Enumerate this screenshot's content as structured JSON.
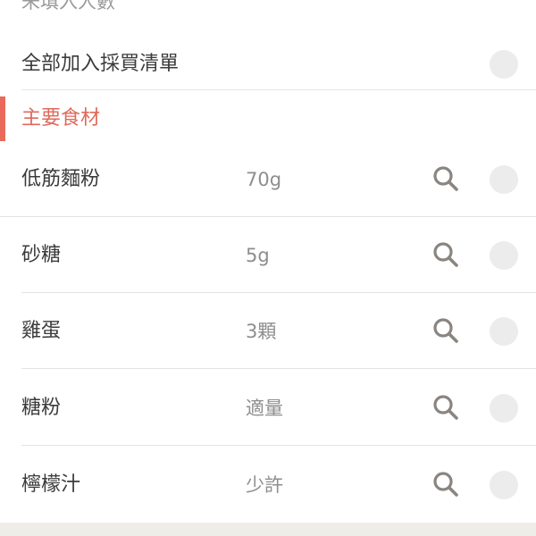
{
  "header_note": "未填入人數",
  "add_all": {
    "label": "全部加入採買清單"
  },
  "section": {
    "title": "主要食材"
  },
  "colors": {
    "accent": "#e96a5a",
    "checkbox": "#ececec",
    "search_icon": "#8a8580"
  },
  "ingredients": [
    {
      "name": "低筋麵粉",
      "qty": "70g"
    },
    {
      "name": "砂糖",
      "qty": "5g"
    },
    {
      "name": "雞蛋",
      "qty": "3顆"
    },
    {
      "name": "糖粉",
      "qty": "適量"
    },
    {
      "name": "檸檬汁",
      "qty": "少許"
    }
  ]
}
